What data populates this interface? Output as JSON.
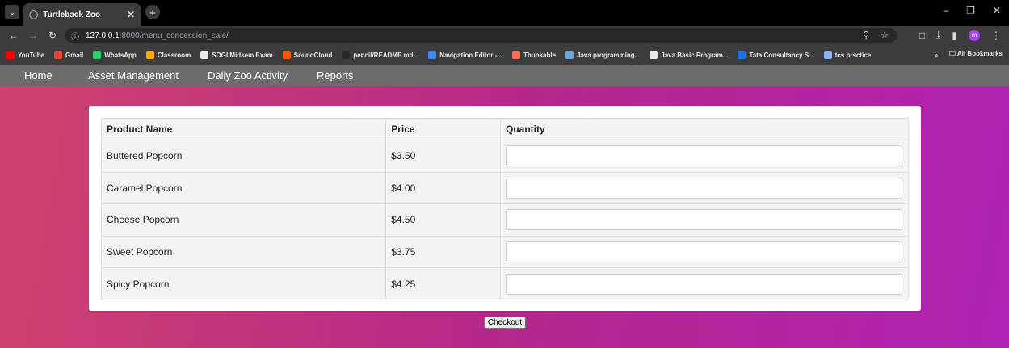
{
  "browser": {
    "tab_title": "Turtleback Zoo",
    "url_host": "127.0.0.1",
    "url_path": ":8000/menu_concession_sale/",
    "bookmarks": [
      {
        "label": "YouTube",
        "color": "#ff0000"
      },
      {
        "label": "Gmail",
        "color": "#ea4335"
      },
      {
        "label": "WhatsApp",
        "color": "#25d366"
      },
      {
        "label": "Classroom",
        "color": "#f9ab00"
      },
      {
        "label": "SOGI Midsem Exam",
        "color": "#e8eaed"
      },
      {
        "label": "SoundCloud",
        "color": "#ff5500"
      },
      {
        "label": "pencil/README.md...",
        "color": "#24292e"
      },
      {
        "label": "Navigation Editor -...",
        "color": "#4285f4"
      },
      {
        "label": "Thunkable",
        "color": "#ff6d5a"
      },
      {
        "label": "Java programming...",
        "color": "#6aa6d6"
      },
      {
        "label": "Java Basic Program...",
        "color": "#e8eaed"
      },
      {
        "label": "Tata Consultancy S...",
        "color": "#1a73e8"
      },
      {
        "label": "tcs prsctice",
        "color": "#8ab4f8"
      }
    ],
    "all_bookmarks": "All Bookmarks"
  },
  "nav": {
    "home": "Home",
    "asset_management": "Asset Management",
    "daily_zoo_activity": "Daily Zoo Activity",
    "reports": "Reports"
  },
  "table": {
    "headers": [
      "Product Name",
      "Price",
      "Quantity"
    ],
    "rows": [
      {
        "name": "Buttered Popcorn",
        "price": "$3.50",
        "quantity": ""
      },
      {
        "name": "Caramel Popcorn",
        "price": "$4.00",
        "quantity": ""
      },
      {
        "name": "Cheese Popcorn",
        "price": "$4.50",
        "quantity": ""
      },
      {
        "name": "Sweet Popcorn",
        "price": "$3.75",
        "quantity": ""
      },
      {
        "name": "Spicy Popcorn",
        "price": "$4.25",
        "quantity": ""
      }
    ]
  },
  "checkout_label": "Checkout"
}
